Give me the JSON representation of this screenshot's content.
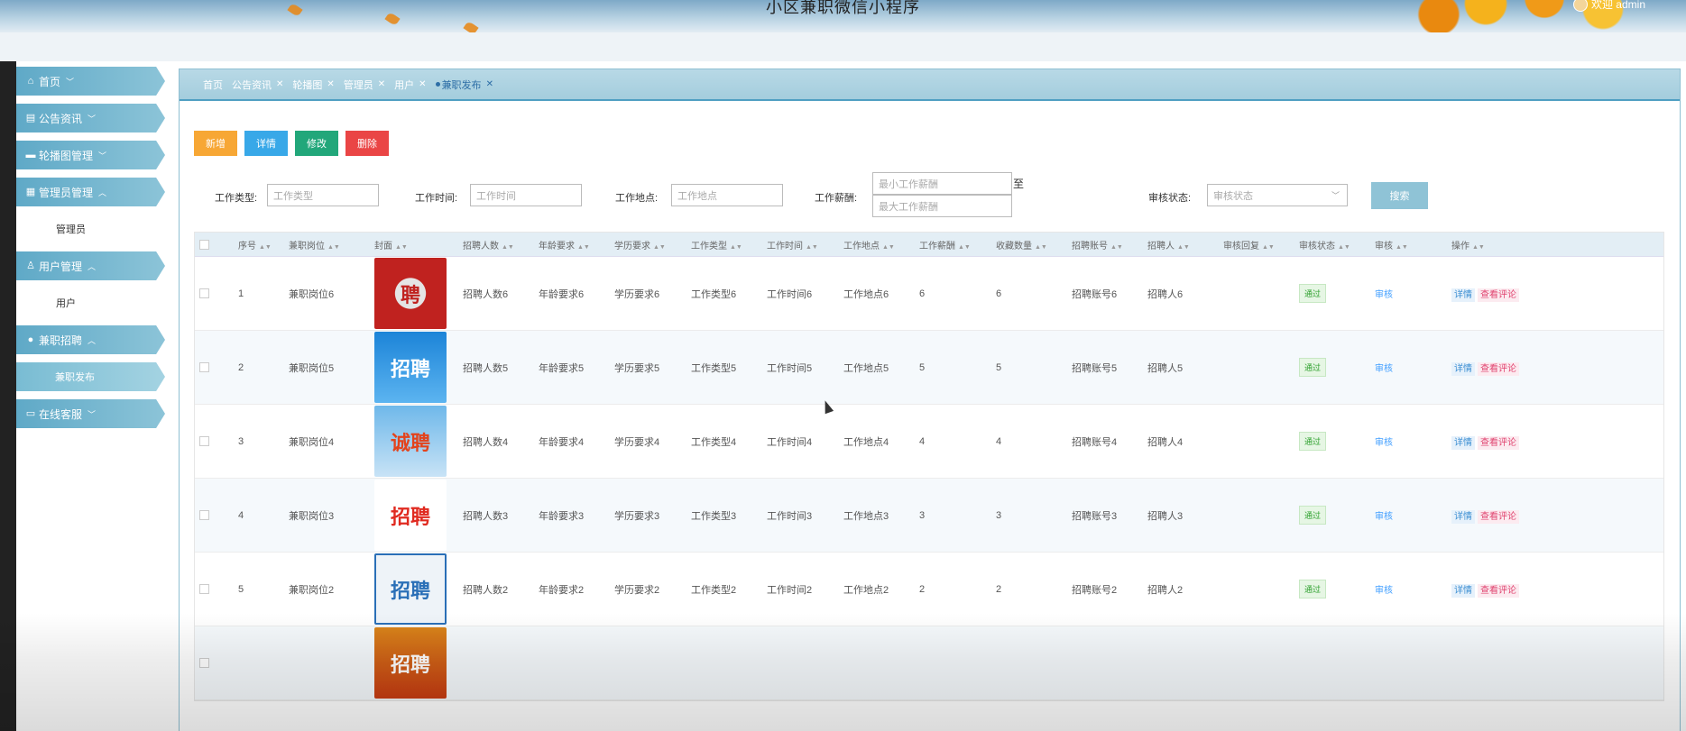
{
  "header": {
    "title": "小区兼职微信小程序",
    "welcome": "欢迎 admin"
  },
  "sidebar": {
    "items": [
      {
        "label": "首页",
        "icon": "home-icon",
        "chevron": "﹀"
      },
      {
        "label": "公告资讯",
        "icon": "news-icon",
        "chevron": "﹀"
      },
      {
        "label": "轮播图管理",
        "icon": "image-icon",
        "chevron": "﹀"
      },
      {
        "label": "管理员管理",
        "icon": "grid-icon",
        "chevron": "︿",
        "children": [
          {
            "label": "管理员"
          }
        ]
      },
      {
        "label": "用户管理",
        "icon": "user-icon",
        "chevron": "︿",
        "children": [
          {
            "label": "用户"
          }
        ]
      },
      {
        "label": "兼职招聘",
        "icon": "chat-icon",
        "chevron": "︿",
        "children": [
          {
            "label": "兼职发布",
            "active": true
          }
        ]
      },
      {
        "label": "在线客服",
        "icon": "service-icon",
        "chevron": "﹀"
      }
    ]
  },
  "tabs": [
    {
      "label": "首页",
      "closable": false
    },
    {
      "label": "公告资讯",
      "closable": true
    },
    {
      "label": "轮播图",
      "closable": true
    },
    {
      "label": "管理员",
      "closable": true
    },
    {
      "label": "用户",
      "closable": true
    },
    {
      "label": "兼职发布",
      "closable": true,
      "active": true
    }
  ],
  "toolbar": {
    "add": "新增",
    "detail": "详情",
    "edit": "修改",
    "delete": "删除"
  },
  "filters": {
    "job_type": {
      "label": "工作类型:",
      "placeholder": "工作类型"
    },
    "job_time": {
      "label": "工作时间:",
      "placeholder": "工作时间"
    },
    "job_place": {
      "label": "工作地点:",
      "placeholder": "工作地点"
    },
    "salary": {
      "label": "工作薪酬:",
      "min_placeholder": "最小工作薪酬",
      "max_placeholder": "最大工作薪酬",
      "separator": "至"
    },
    "audit_status": {
      "label": "审核状态:",
      "placeholder": "审核状态"
    },
    "search": "搜索"
  },
  "table": {
    "columns": [
      "序号",
      "兼职岗位",
      "封面",
      "招聘人数",
      "年龄要求",
      "学历要求",
      "工作类型",
      "工作时间",
      "工作地点",
      "工作薪酬",
      "收藏数量",
      "招聘账号",
      "招聘人",
      "审核回复",
      "审核状态",
      "审核",
      "操作"
    ],
    "rows": [
      {
        "no": "1",
        "post": "兼职岗位6",
        "cover_text": "聘",
        "count": "招聘人数6",
        "age": "年龄要求6",
        "edu": "学历要求6",
        "type": "工作类型6",
        "time": "工作时间6",
        "place": "工作地点6",
        "salary": "6",
        "fav": "6",
        "account": "招聘账号6",
        "recruiter": "招聘人6",
        "reply": "",
        "status": "通过",
        "audit": "审核",
        "op_detail": "详情",
        "op_comment": "查看评论"
      },
      {
        "no": "2",
        "post": "兼职岗位5",
        "cover_text": "招聘",
        "count": "招聘人数5",
        "age": "年龄要求5",
        "edu": "学历要求5",
        "type": "工作类型5",
        "time": "工作时间5",
        "place": "工作地点5",
        "salary": "5",
        "fav": "5",
        "account": "招聘账号5",
        "recruiter": "招聘人5",
        "reply": "",
        "status": "通过",
        "audit": "审核",
        "op_detail": "详情",
        "op_comment": "查看评论"
      },
      {
        "no": "3",
        "post": "兼职岗位4",
        "cover_text": "诚聘",
        "count": "招聘人数4",
        "age": "年龄要求4",
        "edu": "学历要求4",
        "type": "工作类型4",
        "time": "工作时间4",
        "place": "工作地点4",
        "salary": "4",
        "fav": "4",
        "account": "招聘账号4",
        "recruiter": "招聘人4",
        "reply": "",
        "status": "通过",
        "audit": "审核",
        "op_detail": "详情",
        "op_comment": "查看评论"
      },
      {
        "no": "4",
        "post": "兼职岗位3",
        "cover_text": "招聘",
        "count": "招聘人数3",
        "age": "年龄要求3",
        "edu": "学历要求3",
        "type": "工作类型3",
        "time": "工作时间3",
        "place": "工作地点3",
        "salary": "3",
        "fav": "3",
        "account": "招聘账号3",
        "recruiter": "招聘人3",
        "reply": "",
        "status": "通过",
        "audit": "审核",
        "op_detail": "详情",
        "op_comment": "查看评论"
      },
      {
        "no": "5",
        "post": "兼职岗位2",
        "cover_text": "招聘",
        "count": "招聘人数2",
        "age": "年龄要求2",
        "edu": "学历要求2",
        "type": "工作类型2",
        "time": "工作时间2",
        "place": "工作地点2",
        "salary": "2",
        "fav": "2",
        "account": "招聘账号2",
        "recruiter": "招聘人2",
        "reply": "",
        "status": "通过",
        "audit": "审核",
        "op_detail": "详情",
        "op_comment": "查看评论"
      },
      {
        "no": "",
        "post": "",
        "cover_text": "招聘",
        "partial": true
      }
    ]
  },
  "colors": {
    "accent": "#5fa9c7",
    "add": "#f7a735",
    "detail": "#38a8e8",
    "edit": "#22a77a",
    "delete": "#ea4545",
    "pass": "#2ea12e",
    "comment": "#e0436f"
  }
}
